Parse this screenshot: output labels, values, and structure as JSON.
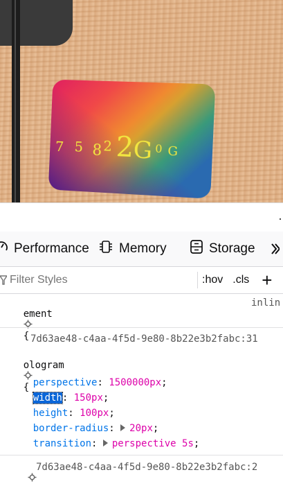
{
  "preview": {
    "hologram_text": [
      "7",
      "5",
      "8",
      "2",
      "2",
      "G",
      "0",
      "G"
    ]
  },
  "devtools": {
    "tabs": [
      {
        "label": "Performance",
        "icon": "performance-icon"
      },
      {
        "label": "Memory",
        "icon": "memory-icon"
      },
      {
        "label": "Storage",
        "icon": "storage-icon"
      }
    ],
    "more_icon": "chevron-more-icon"
  },
  "filter": {
    "placeholder": "Filter Styles",
    "hov": ":hov",
    "cls": ".cls",
    "add": "+"
  },
  "rules": {
    "element_selector": "ement",
    "element_brace": "{",
    "element_source": "inlin",
    "rule1_source": "7d63ae48-c4aa-4f5d-9e80-8b22e3b2fabc:31",
    "rule1_selector": "ologram",
    "rule1_brace": "{",
    "declarations": [
      {
        "prop": "perspective",
        "value": "1500000px"
      },
      {
        "prop": "width",
        "value": "150px"
      },
      {
        "prop": "height",
        "value": "100px"
      },
      {
        "prop": "border-radius",
        "value": "20px"
      },
      {
        "prop": "transition",
        "value": "perspective 5s"
      }
    ],
    "rule2_source": "7d63ae48-c4aa-4f5d-9e80-8b22e3b2fabc:2"
  }
}
